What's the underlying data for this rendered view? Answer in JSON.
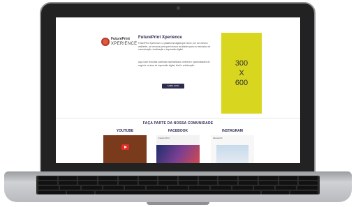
{
  "promo": {
    "logo_line1": "FuturePrint",
    "logo_line2": "XPERIENCE",
    "title": "FuturePrint Xperience",
    "para1": "FuturePrint Xperience é a plataforma digital que reúne, em um mesmo ambiente, os recursos para quem busca novidades para os mercados de comunicação, sinalização e impressão digital.",
    "para2": "Aqui você encontra conteúdo especializado, eventos e oportunidades de negócio na área de impressão digital, têxtil e sublimação.",
    "button_label": "SAIBA MAIS"
  },
  "ad": {
    "line1": "300",
    "line2": "X",
    "line3": "600"
  },
  "community": {
    "title": "FAÇA PARTE DA NOSSA COMUNIDADE",
    "youtube_label": "YOUTUBE",
    "facebook_label": "FACEBOOK",
    "instagram_label": "INSTAGRAM",
    "fb_page_name": "Future Print",
    "ig_account": "futureprint"
  },
  "colors": {
    "ad_background": "#d8d61f",
    "brand_dark": "#2c2c54"
  },
  "icons": {
    "logo": "futureprint-logo-icon",
    "youtube_play": "play-button-icon"
  }
}
